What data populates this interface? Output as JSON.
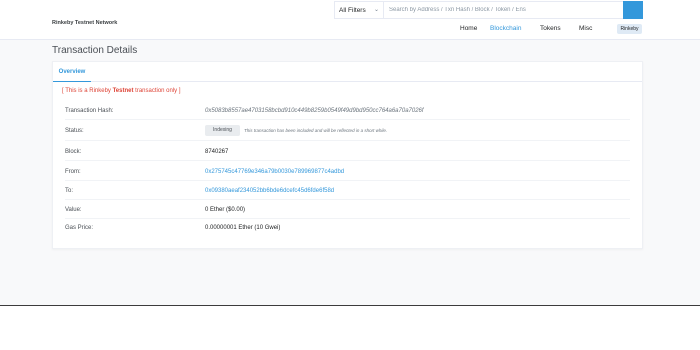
{
  "header": {
    "network_label": "Rinkeby Testnet Network",
    "search": {
      "filter_selected": "All Filters",
      "placeholder": "Search by Address / Txn Hash / Block / Token / Ens"
    },
    "nav": {
      "home": "Home",
      "blockchain": "Blockchain",
      "tokens": "Tokens",
      "misc": "Misc"
    },
    "network_badge": "Rinkeby"
  },
  "page": {
    "title": "Transaction Details"
  },
  "tabs": {
    "overview": "Overview"
  },
  "notice": {
    "prefix": "[ This is a Rinkeby ",
    "emphasis": "Testnet",
    "suffix": " transaction only ]"
  },
  "details": {
    "tx_hash": {
      "label": "Transaction Hash:",
      "value": "0x5083b8557ae4703158bcbd910c449b8259b0549f49d9bd950cc764a6a70a7026f"
    },
    "status": {
      "label": "Status:",
      "value": "Indexing",
      "note": "This transaction has been included and will be reflected in a short while."
    },
    "block": {
      "label": "Block:",
      "value": "8740267"
    },
    "from": {
      "label": "From:",
      "value": "0x275745c47769e346a79b0030e789969877c4adbd"
    },
    "to": {
      "label": "To:",
      "value": "0x09380aeaf234052bb6bde6dcefc45d6fde6f58d"
    },
    "value": {
      "label": "Value:",
      "value": "0 Ether ($0.00)"
    },
    "gas_price": {
      "label": "Gas Price:",
      "value": "0.00000001 Ether (10 Gwei)"
    }
  },
  "colors": {
    "accent": "#3498db",
    "testnet_red": "#de4437",
    "page_bg": "#f8f9fa"
  }
}
